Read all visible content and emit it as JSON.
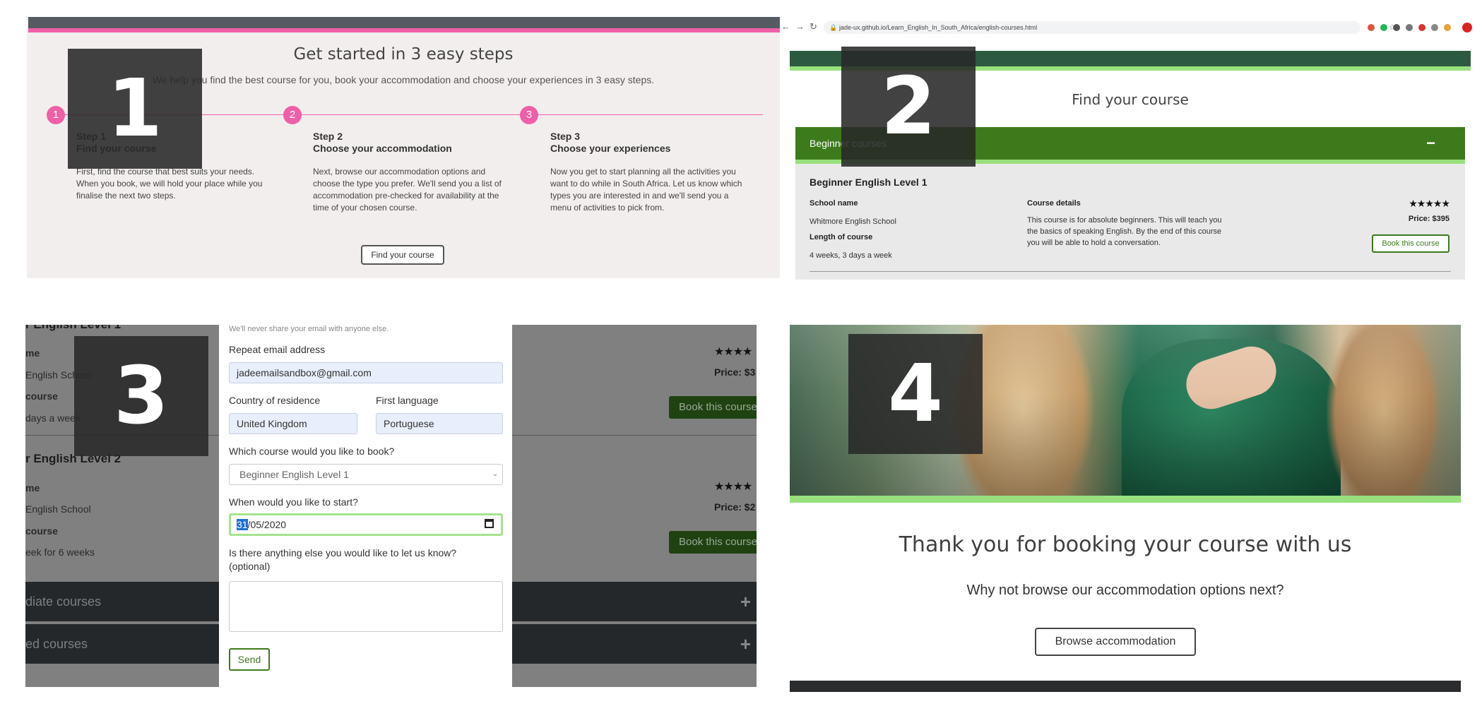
{
  "overlay_numbers": [
    "1",
    "2",
    "3",
    "4"
  ],
  "panel1": {
    "title": "Get started in 3 easy steps",
    "subtitle": "We help you find the best course for you, book your accommodation and choose your experiences in 3 easy steps.",
    "steps": [
      {
        "number": "1",
        "step": "Step 1",
        "heading": "Find your course",
        "text": "First, find the course that best suits your needs. When you book, we will hold your place while you finalise the next two steps."
      },
      {
        "number": "2",
        "step": "Step 2",
        "heading": "Choose your accommodation",
        "text": "Next, browse our accommodation options and choose the type you prefer. We'll send you a list of accommodation pre-checked for availability at the time of your chosen course."
      },
      {
        "number": "3",
        "step": "Step 3",
        "heading": "Choose your experiences",
        "text": "Now you get to start planning all the activities you want to do while in South Africa. Let us know which types you are interested in and we'll send you a menu of activities to pick from."
      }
    ],
    "button": "Find your course",
    "accent_color": "#ef5fa7"
  },
  "panel2": {
    "url": "jade-ux.github.io/Learn_English_In_South_Africa/english-courses.html",
    "icons": [
      "back-arrow-icon",
      "forward-arrow-icon",
      "reload-icon",
      "lock-icon",
      "star-icon"
    ],
    "title": "Find your course",
    "accordion_heading": "Beginner courses",
    "accordion_toggle": "−",
    "course": {
      "title": "Beginner English Level 1",
      "school_label": "School name",
      "school": "Whitmore English School",
      "length_label": "Length of course",
      "length": "4 weeks, 3 days a week",
      "details_label": "Course details",
      "details": "This course is for absolute beginners. This will teach you the basics of speaking English. By the end of this course you will be able to hold a conversation.",
      "stars": "★★★★★",
      "rating": 5,
      "price": "Price: $395",
      "button": "Book this course"
    },
    "accent_color": "#3d7a1c"
  },
  "panel3": {
    "background": {
      "course1_title": "r English Level 1",
      "course1_school_label": "me",
      "course1_school": "English School",
      "course1_length_label": "course",
      "course1_length": "days a week",
      "course1_stars": "★★★★",
      "course1_price": "Price: $3",
      "course2_title": "r English Level 2",
      "course2_school_label": "me",
      "course2_school": "English School",
      "course2_length_label": "course",
      "course2_length": "eek for 6 weeks",
      "course2_stars": "★★★★",
      "course2_price": "Price: $2",
      "book_button": "Book this course",
      "intermediate": "diate courses",
      "advanced": "ed courses",
      "toggle": "+"
    },
    "form": {
      "email_hint": "We'll never share your email with anyone else.",
      "repeat_email_label": "Repeat email address",
      "repeat_email_value": "jadeemailsandbox@gmail.com",
      "country_label": "Country of residence",
      "country_value": "United Kingdom",
      "language_label": "First language",
      "language_value": "Portuguese",
      "course_label": "Which course would you like to book?",
      "course_value": "Beginner English Level 1",
      "start_label": "When would you like to start?",
      "start_day": "31",
      "start_rest": "/05/2020",
      "notes_label_1": "Is there anything else you would like to let us know?",
      "notes_label_2": "(optional)",
      "notes_value": "",
      "send": "Send"
    }
  },
  "panel4": {
    "heading": "Thank you for booking your course with us",
    "subheading": "Why not browse our accommodation options next?",
    "button": "Browse accommodation"
  }
}
